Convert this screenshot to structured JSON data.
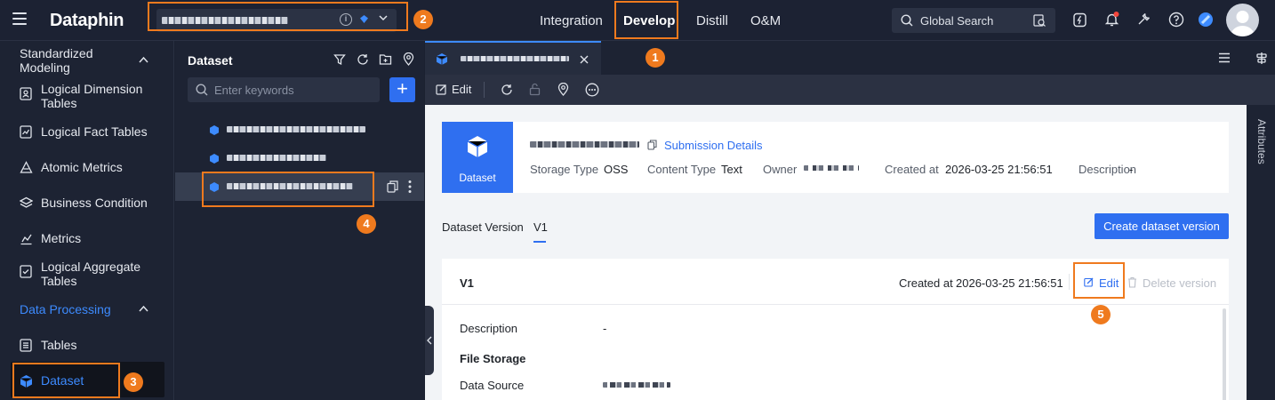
{
  "topbar": {
    "logo": "Dataphin",
    "nav": [
      "Integration",
      "Develop",
      "Distill",
      "O&M"
    ],
    "search_label": "Global Search"
  },
  "sidebar": {
    "group1": "Standardized Modeling",
    "items1": [
      "Logical Dimension Tables",
      "Logical Fact Tables",
      "Atomic Metrics",
      "Business Condition",
      "Metrics",
      "Logical Aggregate Tables"
    ],
    "group2": "Data Processing",
    "items2": [
      "Tables",
      "Dataset"
    ]
  },
  "dataset_panel": {
    "title": "Dataset",
    "search_placeholder": "Enter keywords"
  },
  "toolbar": {
    "edit_label": "Edit"
  },
  "attributes_label": "Attributes",
  "dataset_card": {
    "badge_label": "Dataset",
    "submission_link": "Submission Details",
    "storage_type_label": "Storage Type",
    "storage_type": "OSS",
    "content_type_label": "Content Type",
    "content_type": "Text",
    "owner_label": "Owner",
    "created_at_label": "Created at",
    "created_at": "2026-03-25 21:56:51",
    "description_label": "Description",
    "description": "-"
  },
  "versions": {
    "tab_label": "Dataset Version",
    "active_version": "V1",
    "create_button": "Create dataset version"
  },
  "version_card": {
    "title": "V1",
    "created_at_label": "Created at",
    "created_at": "2026-03-25 21:56:51",
    "edit_label": "Edit",
    "delete_label": "Delete version",
    "description_label": "Description",
    "description": "-",
    "file_storage_label": "File Storage",
    "data_source_label": "Data Source"
  },
  "annotations": [
    "1",
    "2",
    "3",
    "4",
    "5"
  ],
  "colors": {
    "accent": "#2f6ff0",
    "highlight": "#ef7a1e",
    "dark_bg": "#1d2333"
  }
}
